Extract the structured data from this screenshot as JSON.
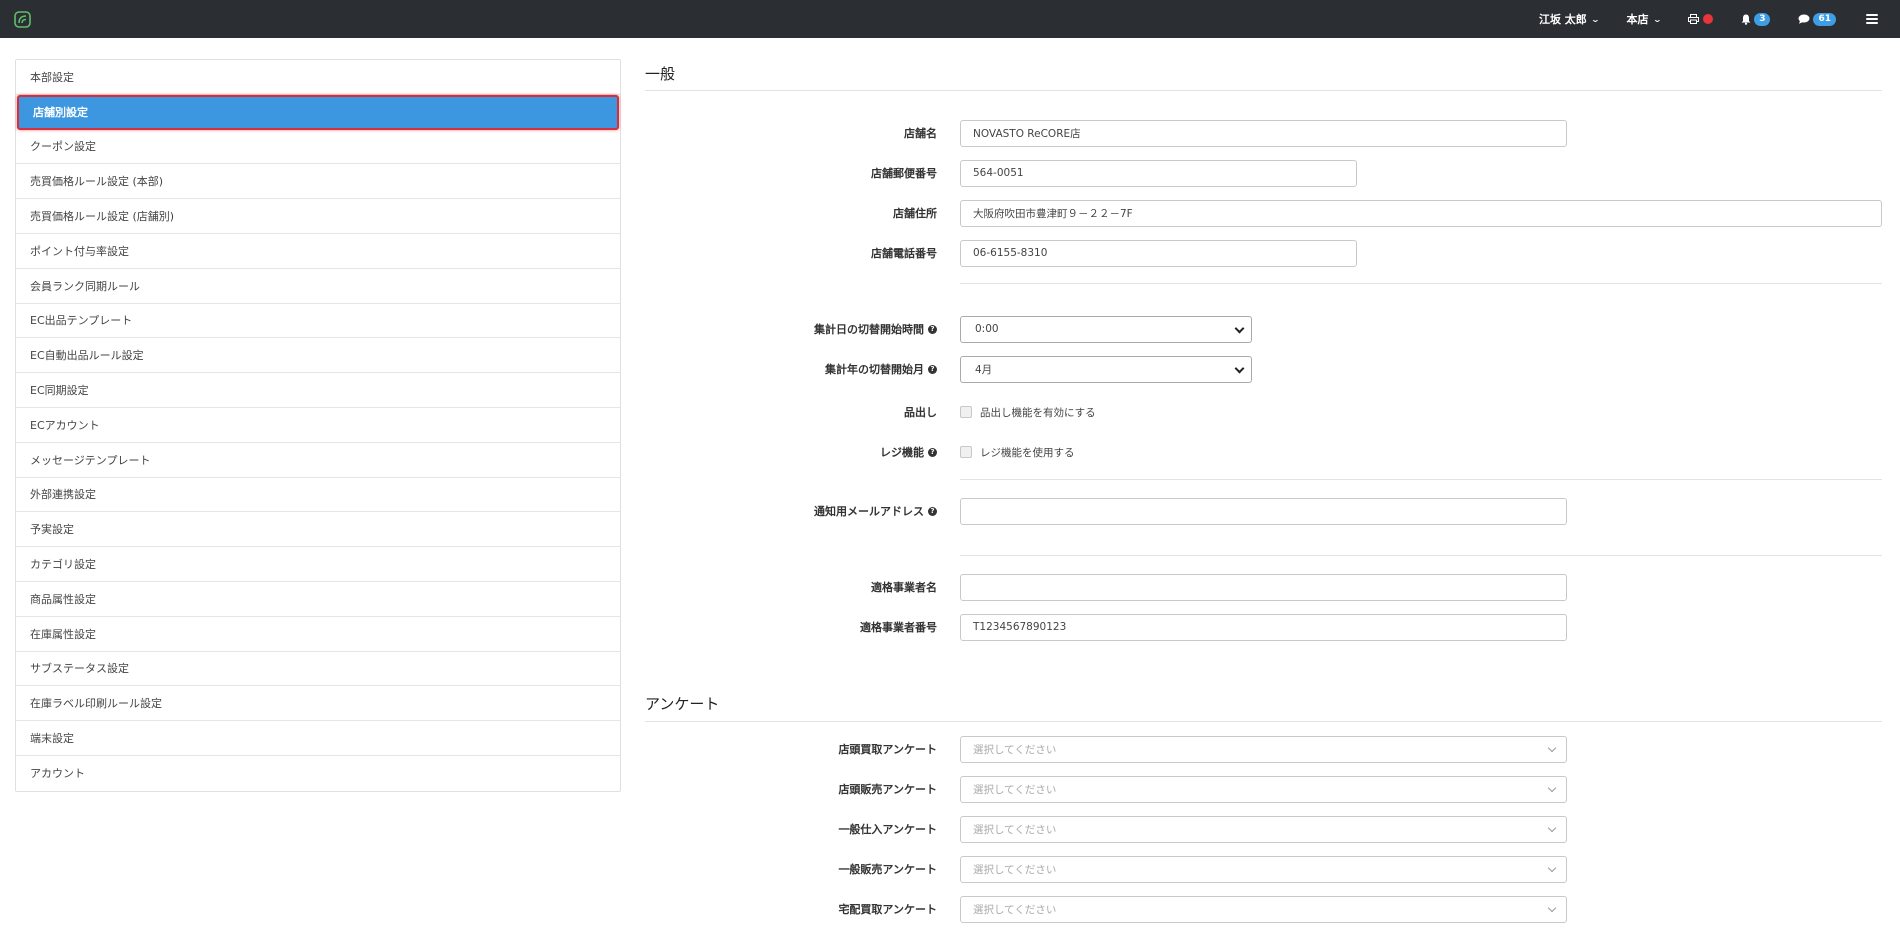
{
  "navbar": {
    "user_name": "江坂 太郎",
    "store": "本店",
    "notification_count": "3",
    "message_count": "61",
    "colors": {
      "bg": "#2b2f33",
      "badge": "#3d9ee6",
      "alert": "#e8353b"
    }
  },
  "sidebar": {
    "items": [
      {
        "label": "本部設定"
      },
      {
        "label": "店舗別設定"
      },
      {
        "label": "クーポン設定"
      },
      {
        "label": "売買価格ルール設定 (本部)"
      },
      {
        "label": "売買価格ルール設定 (店舗別)"
      },
      {
        "label": "ポイント付与率設定"
      },
      {
        "label": "会員ランク同期ルール"
      },
      {
        "label": "EC出品テンプレート"
      },
      {
        "label": "EC自動出品ルール設定"
      },
      {
        "label": "EC同期設定"
      },
      {
        "label": "ECアカウント"
      },
      {
        "label": "メッセージテンプレート"
      },
      {
        "label": "外部連携設定"
      },
      {
        "label": "予実設定"
      },
      {
        "label": "カテゴリ設定"
      },
      {
        "label": "商品属性設定"
      },
      {
        "label": "在庫属性設定"
      },
      {
        "label": "サブステータス設定"
      },
      {
        "label": "在庫ラベル印刷ルール設定"
      },
      {
        "label": "端末設定"
      },
      {
        "label": "アカウント"
      }
    ],
    "active_index": 1,
    "active_color": "#3c97e0"
  },
  "general": {
    "title": "一般",
    "store_name_label": "店舗名",
    "store_name_value": "NOVASTO ReCORE店",
    "postal_label": "店舗郵便番号",
    "postal_value": "564-0051",
    "address_label": "店舗住所",
    "address_value": "大阪府吹田市豊津町９－２２－7F",
    "phone_label": "店舗電話番号",
    "phone_value": "06-6155-8310",
    "day_switch_label": "集計日の切替開始時間",
    "day_switch_value": "0:00",
    "year_switch_label": "集計年の切替開始月",
    "year_switch_value": "4月",
    "display_label": "品出し",
    "display_checkbox": "品出し機能を有効にする",
    "register_label": "レジ機能",
    "register_checkbox": "レジ機能を使用する",
    "email_label": "通知用メールアドレス",
    "email_value": "",
    "invoice_name_label": "適格事業者名",
    "invoice_name_value": "",
    "invoice_number_label": "適格事業者番号",
    "invoice_number_value": "T1234567890123"
  },
  "survey": {
    "title": "アンケート",
    "placeholder": "選択してください",
    "fields": [
      {
        "label": "店頭買取アンケート"
      },
      {
        "label": "店頭販売アンケート"
      },
      {
        "label": "一般仕入アンケート"
      },
      {
        "label": "一般販売アンケート"
      },
      {
        "label": "宅配買取アンケート"
      }
    ]
  }
}
